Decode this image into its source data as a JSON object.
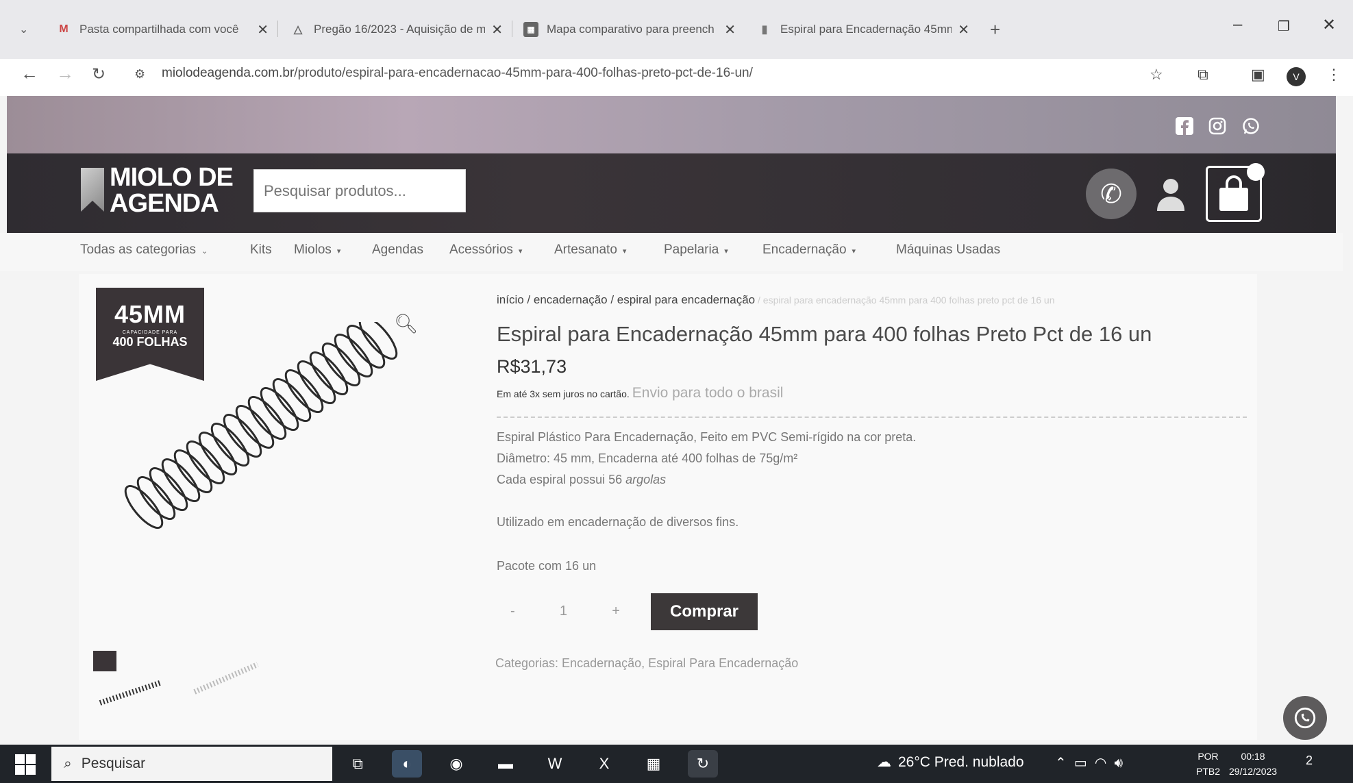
{
  "browser": {
    "tabs": [
      {
        "label": "Pasta compartilhada com você",
        "icon": "gmail-icon"
      },
      {
        "label": "Pregão 16/2023 - Aquisição de m",
        "icon": "drive-icon"
      },
      {
        "label": "Mapa comparativo para preench",
        "icon": "sheets-icon"
      },
      {
        "label": "Espiral para Encadernação 45mm",
        "icon": "bookmark-icon"
      }
    ],
    "url_host": "miolodeagenda.com.br",
    "url_path": "/produto/espiral-para-encadernacao-45mm-para-400-folhas-preto-pct-de-16-un/",
    "profile_initial": "V"
  },
  "site": {
    "logo_line1": "MIOLO DE",
    "logo_line2": "AGENDA",
    "search_placeholder": "Pesquisar produtos...",
    "menu": [
      {
        "label": "Todas as categorias",
        "caret": "⌄"
      },
      {
        "label": "Kits",
        "caret": ""
      },
      {
        "label": "Miolos",
        "caret": "▾"
      },
      {
        "label": "Agendas",
        "caret": ""
      },
      {
        "label": "Acessórios",
        "caret": "▾"
      },
      {
        "label": "Artesanato",
        "caret": "▾"
      },
      {
        "label": "Papelaria",
        "caret": "▾"
      },
      {
        "label": "Encadernação",
        "caret": "▾"
      },
      {
        "label": "Máquinas Usadas",
        "caret": ""
      }
    ]
  },
  "product": {
    "badge_big": "45MM",
    "badge_small": "CAPACIDADE PARA",
    "badge_mid": "400 FOLHAS",
    "breadcrumb": {
      "home": "início",
      "sep": " / ",
      "cat1": "encadernação",
      "cat2": "espiral para encadernação",
      "current": "espiral para encadernação 45mm para 400 folhas preto pct de 16 un"
    },
    "title": "Espiral para Encadernação 45mm para 400 folhas Preto Pct de 16 un",
    "price": "R$31,73",
    "installments": "Em até 3x sem juros no cartão.",
    "shipping": "Envio para todo o brasil",
    "desc1": "Espiral Plástico Para Encadernação, Feito em PVC Semi-rígido na cor preta.",
    "desc2": "Diâmetro: 45 mm, Encaderna até 400 folhas de 75g/m²",
    "desc3_prefix": "Cada espiral possui 56 ",
    "desc3_em": "argolas",
    "desc4": "Utilizado em encadernação de diversos fins.",
    "desc5": "Pacote com 16 un",
    "qty_minus": "-",
    "qty_value": "1",
    "qty_plus": "+",
    "buy_label": "Comprar",
    "categories": "Categorias: Encadernação, Espiral Para Encadernação"
  },
  "taskbar": {
    "search_label": "Pesquisar",
    "weather": "26°C  Pred. nublado",
    "lang1": "POR",
    "lang2": "PTB2",
    "time": "00:18",
    "date": "29/12/2023",
    "notif_count": "2"
  }
}
